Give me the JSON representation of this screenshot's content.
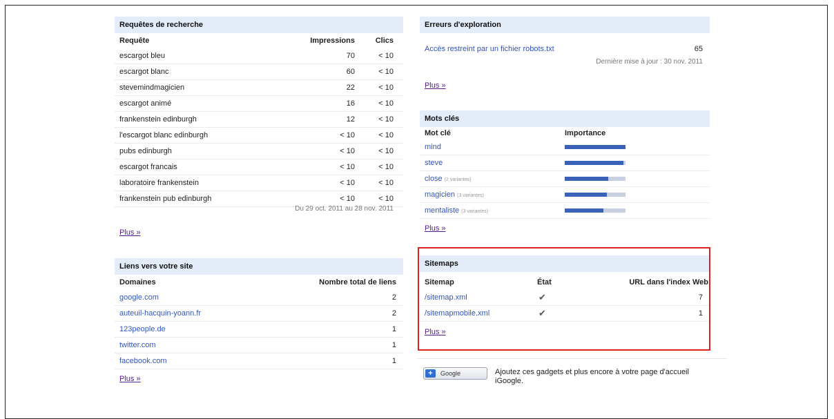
{
  "queries": {
    "title": "Requêtes de recherche",
    "columns": [
      "Requête",
      "Impressions",
      "Clics"
    ],
    "rows": [
      {
        "query": "escargot bleu",
        "impressions": "70",
        "clicks": "< 10"
      },
      {
        "query": "escargot blanc",
        "impressions": "60",
        "clicks": "< 10"
      },
      {
        "query": "stevemindmagicien",
        "impressions": "22",
        "clicks": "< 10"
      },
      {
        "query": "escargot animé",
        "impressions": "16",
        "clicks": "< 10"
      },
      {
        "query": "frankenstein edinburgh",
        "impressions": "12",
        "clicks": "< 10"
      },
      {
        "query": "l'escargot blanc edinburgh",
        "impressions": "< 10",
        "clicks": "< 10"
      },
      {
        "query": "pubs edinburgh",
        "impressions": "< 10",
        "clicks": "< 10"
      },
      {
        "query": "escargot francais",
        "impressions": "< 10",
        "clicks": "< 10"
      },
      {
        "query": "laboratoire frankenstein",
        "impressions": "< 10",
        "clicks": "< 10"
      },
      {
        "query": "frankenstein pub edinburgh",
        "impressions": "< 10",
        "clicks": "< 10"
      }
    ],
    "date_range": "Du 29 oct. 2011 au 28 nov. 2011",
    "more": "Plus »"
  },
  "links": {
    "title": "Liens vers votre site",
    "columns": [
      "Domaines",
      "Nombre total de liens"
    ],
    "rows": [
      {
        "domain": "google.com",
        "count": "2"
      },
      {
        "domain": "auteuil-hacquin-yoann.fr",
        "count": "2"
      },
      {
        "domain": "123people.de",
        "count": "1"
      },
      {
        "domain": "twitter.com",
        "count": "1"
      },
      {
        "domain": "facebook.com",
        "count": "1"
      }
    ],
    "more": "Plus »"
  },
  "crawl_errors": {
    "title": "Erreurs d'exploration",
    "item": {
      "label": "Accès restreint par un fichier robots.txt",
      "count": "65"
    },
    "updated": "Dernière mise à jour : 30 nov. 2011",
    "more": "Plus »"
  },
  "keywords": {
    "title": "Mots clés",
    "columns": [
      "Mot clé",
      "Importance"
    ],
    "rows": [
      {
        "word": "mind",
        "variant": "",
        "importance": 1.0
      },
      {
        "word": "steve",
        "variant": "",
        "importance": 0.97
      },
      {
        "word": "close",
        "variant": "(2 variantes)",
        "importance": 0.72
      },
      {
        "word": "magicien",
        "variant": "(3 variantes)",
        "importance": 0.69
      },
      {
        "word": "mentaliste",
        "variant": "(3 variantes)",
        "importance": 0.64
      }
    ],
    "more": "Plus »"
  },
  "sitemaps": {
    "title": "Sitemaps",
    "columns": [
      "Sitemap",
      "État",
      "URL dans l'index Web"
    ],
    "rows": [
      {
        "path": "/sitemap.xml",
        "state": "✔",
        "indexed": "7"
      },
      {
        "path": "/sitemapmobile.xml",
        "state": "✔",
        "indexed": "1"
      }
    ],
    "more": "Plus »"
  },
  "igoogle": {
    "button": "Google",
    "text": "Ajoutez ces gadgets et plus encore à votre page d'accueil iGoogle."
  },
  "colors": {
    "accent": "#3a62b8",
    "header_bg": "#e5ecf9",
    "highlight": "#e02020"
  }
}
